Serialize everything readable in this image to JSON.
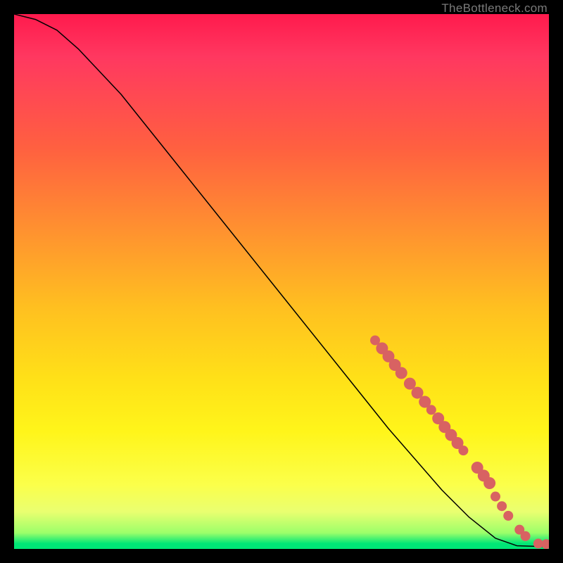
{
  "watermark": "TheBottleneck.com",
  "chart_data": {
    "type": "line",
    "title": "",
    "xlabel": "",
    "ylabel": "",
    "xlim": [
      0,
      100
    ],
    "ylim": [
      0,
      100
    ],
    "curve": {
      "name": "bottleneck-curve",
      "points": [
        {
          "x": 0,
          "y": 100.0
        },
        {
          "x": 4,
          "y": 99.0
        },
        {
          "x": 8,
          "y": 97.0
        },
        {
          "x": 12,
          "y": 93.5
        },
        {
          "x": 20,
          "y": 85.0
        },
        {
          "x": 30,
          "y": 72.5
        },
        {
          "x": 40,
          "y": 60.0
        },
        {
          "x": 50,
          "y": 47.5
        },
        {
          "x": 60,
          "y": 35.0
        },
        {
          "x": 70,
          "y": 22.5
        },
        {
          "x": 80,
          "y": 11.0
        },
        {
          "x": 85,
          "y": 6.0
        },
        {
          "x": 90,
          "y": 2.0
        },
        {
          "x": 94,
          "y": 0.6
        },
        {
          "x": 100,
          "y": 0.4
        }
      ]
    },
    "markers": [
      {
        "x": 67.5,
        "y": 39.0,
        "size": "sm"
      },
      {
        "x": 68.8,
        "y": 37.5,
        "size": "lg"
      },
      {
        "x": 70.0,
        "y": 36.0,
        "size": "lg"
      },
      {
        "x": 71.2,
        "y": 34.4,
        "size": "lg"
      },
      {
        "x": 72.4,
        "y": 32.9,
        "size": "lg"
      },
      {
        "x": 74.0,
        "y": 30.9,
        "size": "lg"
      },
      {
        "x": 75.4,
        "y": 29.2,
        "size": "lg"
      },
      {
        "x": 76.8,
        "y": 27.5,
        "size": "lg"
      },
      {
        "x": 78.0,
        "y": 26.0,
        "size": "sm"
      },
      {
        "x": 79.3,
        "y": 24.4,
        "size": "lg"
      },
      {
        "x": 80.5,
        "y": 22.8,
        "size": "lg"
      },
      {
        "x": 81.7,
        "y": 21.3,
        "size": "lg"
      },
      {
        "x": 82.9,
        "y": 19.8,
        "size": "lg"
      },
      {
        "x": 84.0,
        "y": 18.4,
        "size": "sm"
      },
      {
        "x": 86.6,
        "y": 15.2,
        "size": "lg"
      },
      {
        "x": 87.8,
        "y": 13.7,
        "size": "lg"
      },
      {
        "x": 88.9,
        "y": 12.3,
        "size": "lg"
      },
      {
        "x": 90.0,
        "y": 9.8,
        "size": "sm"
      },
      {
        "x": 91.2,
        "y": 8.0,
        "size": "sm"
      },
      {
        "x": 92.4,
        "y": 6.2,
        "size": "sm"
      },
      {
        "x": 94.5,
        "y": 3.6,
        "size": "sm"
      },
      {
        "x": 95.6,
        "y": 2.4,
        "size": "sm"
      },
      {
        "x": 98.0,
        "y": 1.0,
        "size": "sm"
      },
      {
        "x": 99.5,
        "y": 0.9,
        "size": "sm"
      }
    ]
  }
}
